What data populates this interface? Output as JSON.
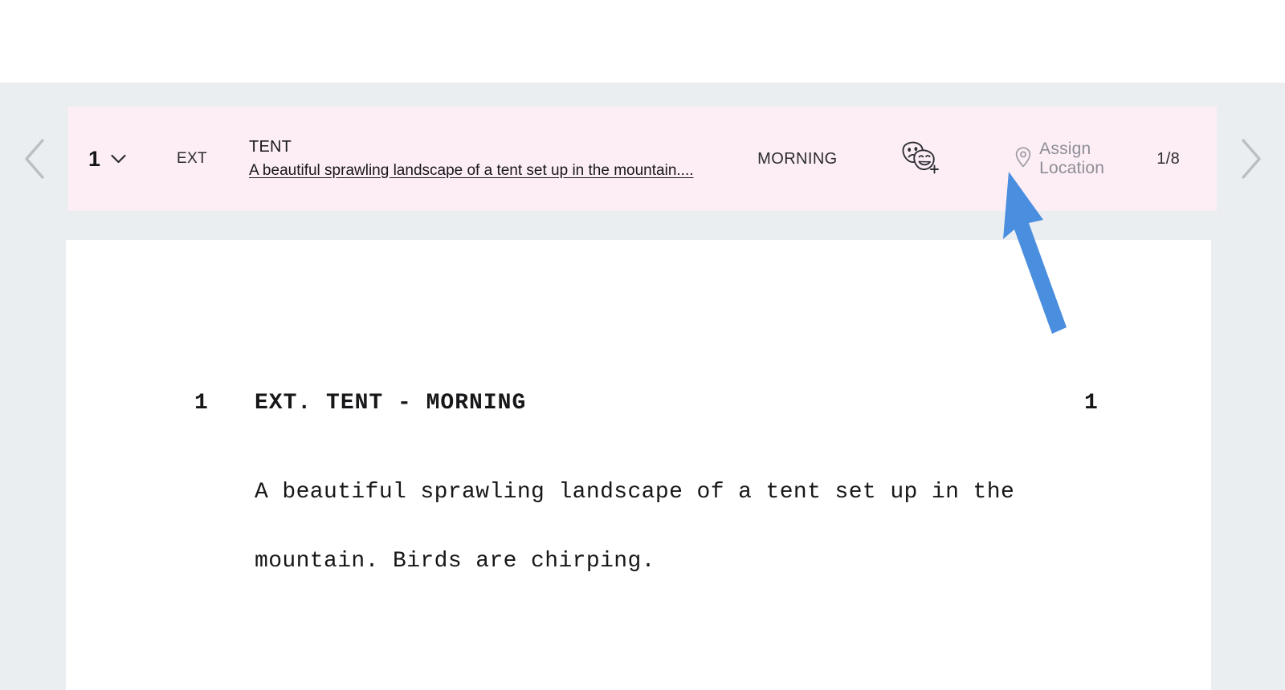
{
  "scene_bar": {
    "scene_number": "1",
    "int_ext": "EXT",
    "scene_title": "TENT",
    "scene_synopsis": "A beautiful sprawling landscape of a tent set up in the mountain....",
    "time_of_day": "MORNING",
    "assign_location_label": "Assign Location",
    "page_eighths": "1/8",
    "cast_icon": "theater-masks-add-icon",
    "location_icon": "map-pin-icon",
    "scene_number_chevron_icon": "chevron-down-icon",
    "prev_icon": "chevron-left-icon",
    "next_icon": "chevron-right-icon",
    "background_color": "#fdeef5"
  },
  "script": {
    "slug_number_left": "1",
    "slug_heading": "EXT. TENT - MORNING",
    "slug_number_right": "1",
    "action_line_1": "A beautiful sprawling landscape of a tent set up in the",
    "action_line_2": "mountain. Birds are chirping."
  },
  "annotation": {
    "pointer_icon": "blue-arrow-pointer",
    "pointer_color": "#4a8ee0",
    "points_at": "Assign Location"
  },
  "colors": {
    "workspace_background": "#eaeef0",
    "page_background": "#ffffff",
    "scene_bar_pink": "#fdeef5",
    "muted_text": "#8d8d96",
    "body_text": "#17171a",
    "arrow_gray": "#b9bfc3"
  }
}
